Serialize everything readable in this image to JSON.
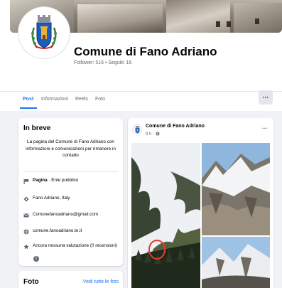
{
  "page": {
    "name": "Comune di Fano Adriano",
    "followers_line": "Follower: 516 • Seguiti: 16"
  },
  "tabs": [
    {
      "label": "Post",
      "active": true
    },
    {
      "label": "Informazioni",
      "active": false
    },
    {
      "label": "Reels",
      "active": false
    },
    {
      "label": "Foto",
      "active": false
    }
  ],
  "more_label": "···",
  "intro": {
    "title": "In breve",
    "description": "La pagina del Comune di Fano Adriano con informazioni e comunicazioni per rimanere in contatto",
    "rows": [
      {
        "icon": "flag-icon",
        "bold": "Pagina",
        "text": " · Ente pubblico"
      },
      {
        "icon": "location-icon",
        "bold": "",
        "text": "Fano Adriano, Italy"
      },
      {
        "icon": "email-icon",
        "bold": "",
        "text": "Comunefanoadriano@gmail.com"
      },
      {
        "icon": "globe-icon",
        "bold": "",
        "text": "comune.fanoadriano.te.it"
      },
      {
        "icon": "star-icon",
        "bold": "",
        "text": "Ancora nessuna valutazione (0 recensioni)"
      }
    ]
  },
  "photos_card": {
    "title": "Foto",
    "link": "Vedi tutte le foto"
  },
  "post": {
    "author": "Comune di Fano Adriano",
    "time": "9 h · ",
    "menu": "···"
  },
  "colors": {
    "accent": "#1877f2",
    "background": "#f0f2f5",
    "secondary_text": "#65676b"
  }
}
